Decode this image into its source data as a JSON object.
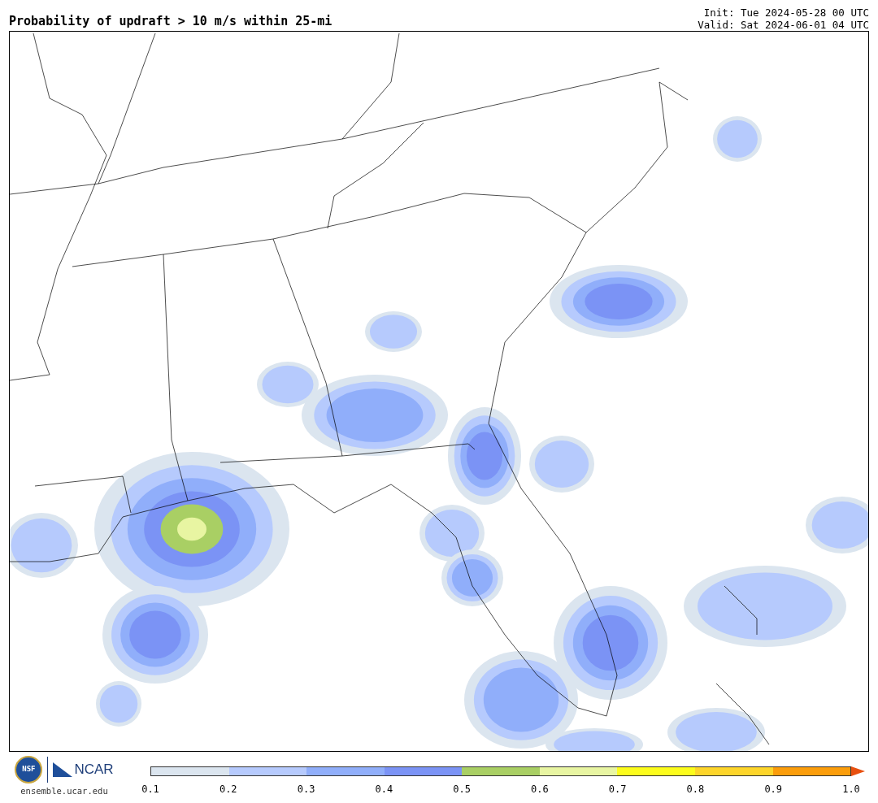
{
  "title": "Probability of updraft > 10 m/s within 25-mi",
  "init": "Init: Tue 2024-05-28 00 UTC",
  "valid": "Valid: Sat 2024-06-01 04 UTC",
  "logos": {
    "nsf": "NSF",
    "ncar": "NCAR"
  },
  "site": "ensemble.ucar.edu",
  "colorbar": {
    "bins": [
      {
        "kind": "bin",
        "color": "#dbe5ef"
      },
      {
        "kind": "bin",
        "color": "#b6cafd"
      },
      {
        "kind": "bin",
        "color": "#90aefa"
      },
      {
        "kind": "bin",
        "color": "#7b93f5"
      },
      {
        "kind": "bin",
        "color": "#a9cf64"
      },
      {
        "kind": "bin",
        "color": "#e8f5a2"
      },
      {
        "kind": "bin",
        "color": "#fcfc1c"
      },
      {
        "kind": "bin",
        "color": "#fdd52a"
      },
      {
        "kind": "bin",
        "color": "#fb9d0b"
      },
      {
        "kind": "arrow",
        "color": "#e8500f"
      }
    ],
    "ticks": [
      "0.1",
      "0.2",
      "0.3",
      "0.4",
      "0.5",
      "0.6",
      "0.7",
      "0.8",
      "0.9",
      "1.0"
    ]
  }
}
